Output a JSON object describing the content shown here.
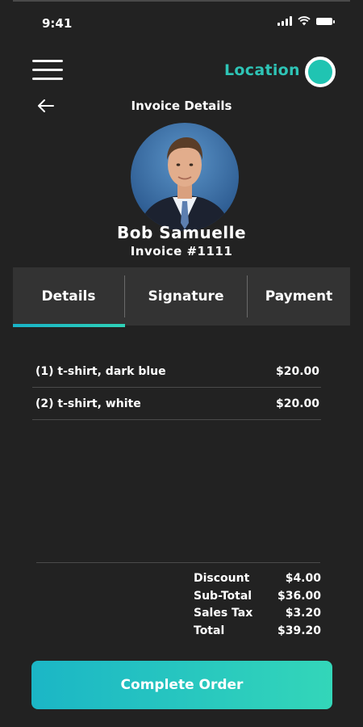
{
  "status_bar": {
    "time": "9:41"
  },
  "header": {
    "location_label": "Location"
  },
  "page": {
    "title": "Invoice Details"
  },
  "customer": {
    "name": "Bob Samuelle",
    "invoice": "Invoice #1111"
  },
  "tabs": [
    {
      "label": "Details",
      "active": true
    },
    {
      "label": "Signature",
      "active": false
    },
    {
      "label": "Payment",
      "active": false
    }
  ],
  "items": [
    {
      "description": "(1) t-shirt, dark blue",
      "price": "$20.00"
    },
    {
      "description": "(2) t-shirt, white",
      "price": "$20.00"
    }
  ],
  "totals": [
    {
      "label": "Discount",
      "value": "$4.00"
    },
    {
      "label": "Sub-Total",
      "value": "$36.00"
    },
    {
      "label": "Sales Tax",
      "value": "$3.20"
    },
    {
      "label": "Total",
      "value": "$39.20"
    }
  ],
  "actions": {
    "complete_label": "Complete Order"
  },
  "colors": {
    "accent": "#2ec4b6",
    "background": "#222222",
    "tab_bar": "#333333"
  }
}
